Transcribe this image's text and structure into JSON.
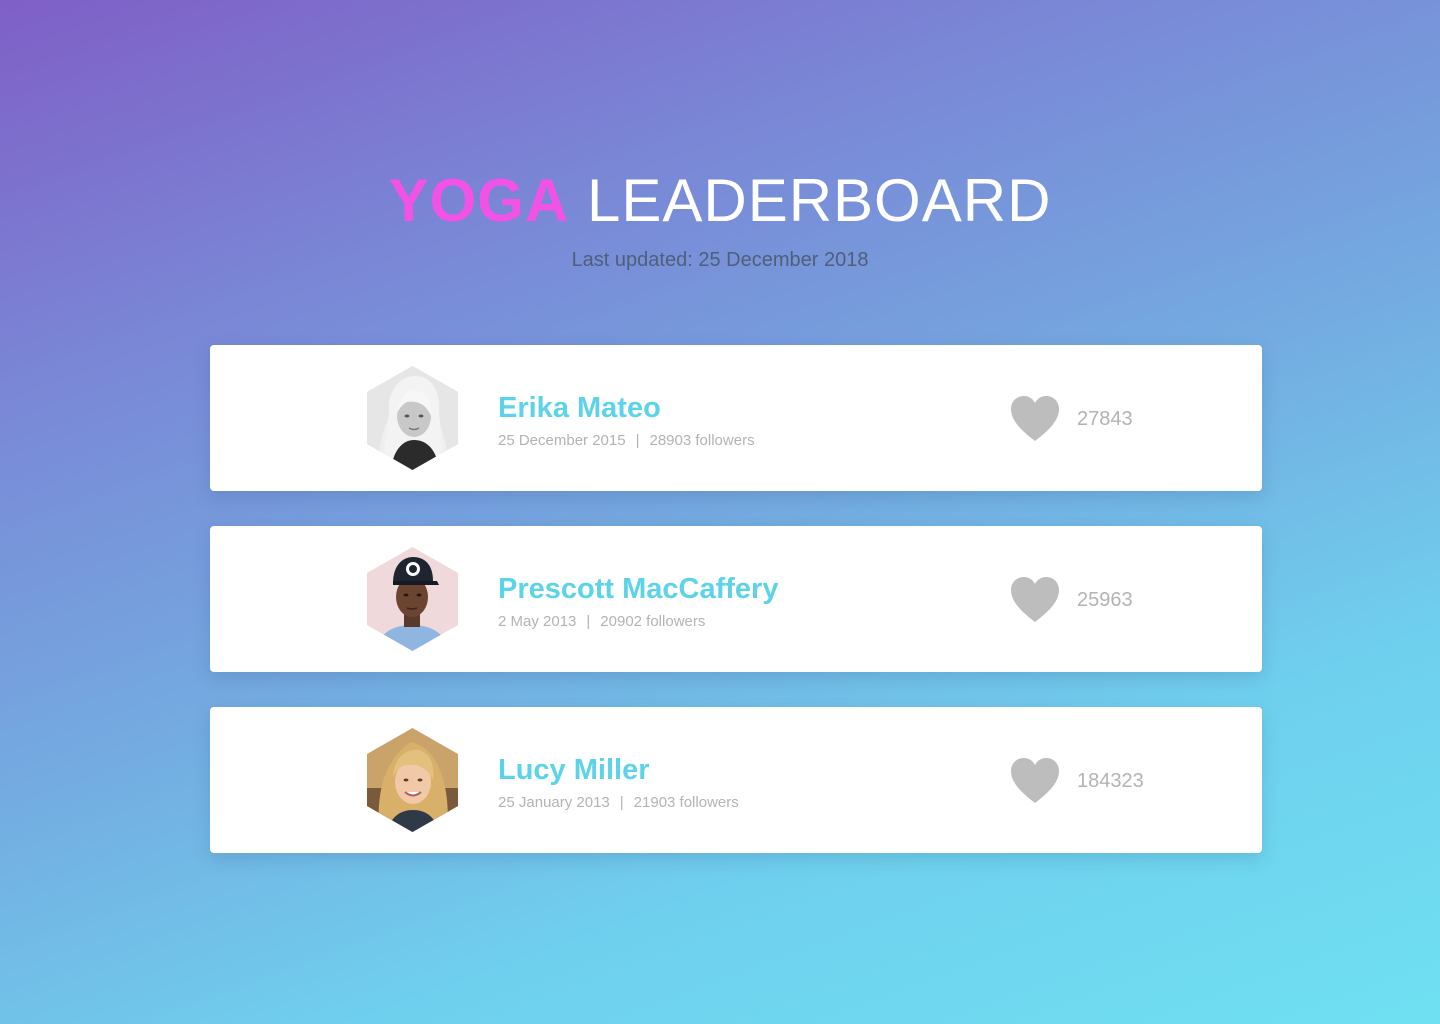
{
  "header": {
    "title_accent": "YOGA",
    "title_rest": "LEADERBOARD",
    "subtitle": "Last updated: 25 December 2018"
  },
  "leaderboard": [
    {
      "name": "Erika Mateo",
      "date": "25 December 2015",
      "separator": "|",
      "followers": "28903 followers",
      "likes": "27843",
      "avatar_icon": "user-avatar",
      "like_icon": "heart-icon"
    },
    {
      "name": "Prescott MacCaffery",
      "date": "2 May 2013",
      "separator": "|",
      "followers": "20902 followers",
      "likes": "25963",
      "avatar_icon": "user-avatar",
      "like_icon": "heart-icon"
    },
    {
      "name": "Lucy Miller",
      "date": "25 January 2013",
      "separator": "|",
      "followers": "21903 followers",
      "likes": "184323",
      "avatar_icon": "user-avatar",
      "like_icon": "heart-icon"
    }
  ],
  "colors": {
    "accent_title": "#f252e6",
    "name_color": "#5cd3e9",
    "muted_text": "#b3b3b3",
    "heart": "#bdbdbd"
  }
}
